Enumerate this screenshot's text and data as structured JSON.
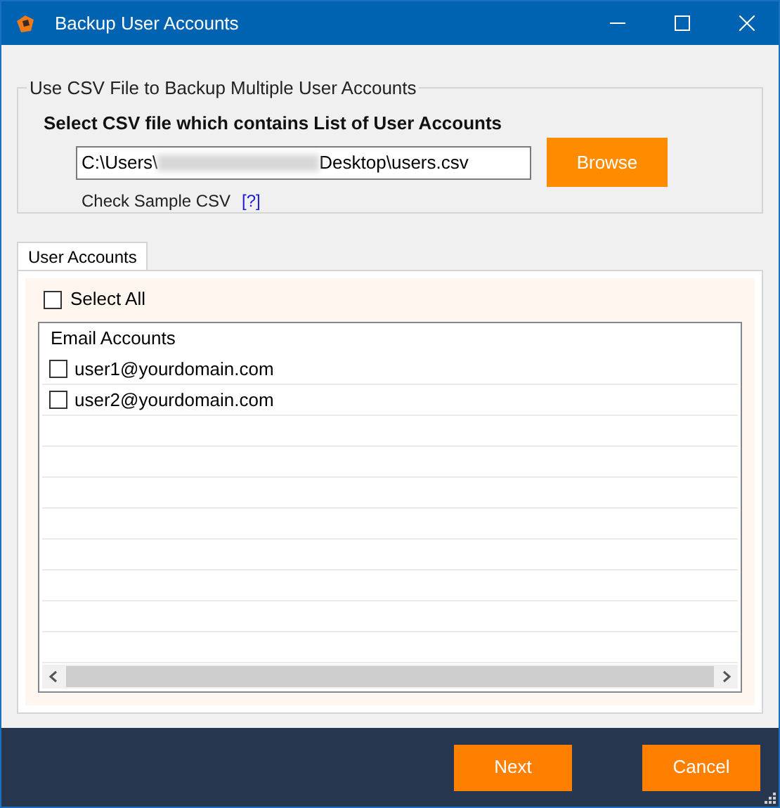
{
  "window": {
    "title": "Backup User Accounts"
  },
  "csv_group": {
    "legend": "Use CSV File to Backup Multiple User Accounts",
    "heading": "Select CSV file which contains List of User Accounts",
    "path_prefix": "C:\\Users\\",
    "path_suffix": "Desktop\\users.csv",
    "browse": "Browse",
    "sample_label": "Check Sample CSV",
    "sample_link": "[?]"
  },
  "tabs": [
    {
      "label": "User Accounts",
      "selected": true
    }
  ],
  "select_all": {
    "label": "Select All",
    "checked": false
  },
  "list": {
    "header": "Email Accounts",
    "rows": [
      {
        "email": "user1@yourdomain.com",
        "checked": false
      },
      {
        "email": "user2@yourdomain.com",
        "checked": false
      }
    ]
  },
  "buttons": [
    "Next",
    "Cancel"
  ]
}
